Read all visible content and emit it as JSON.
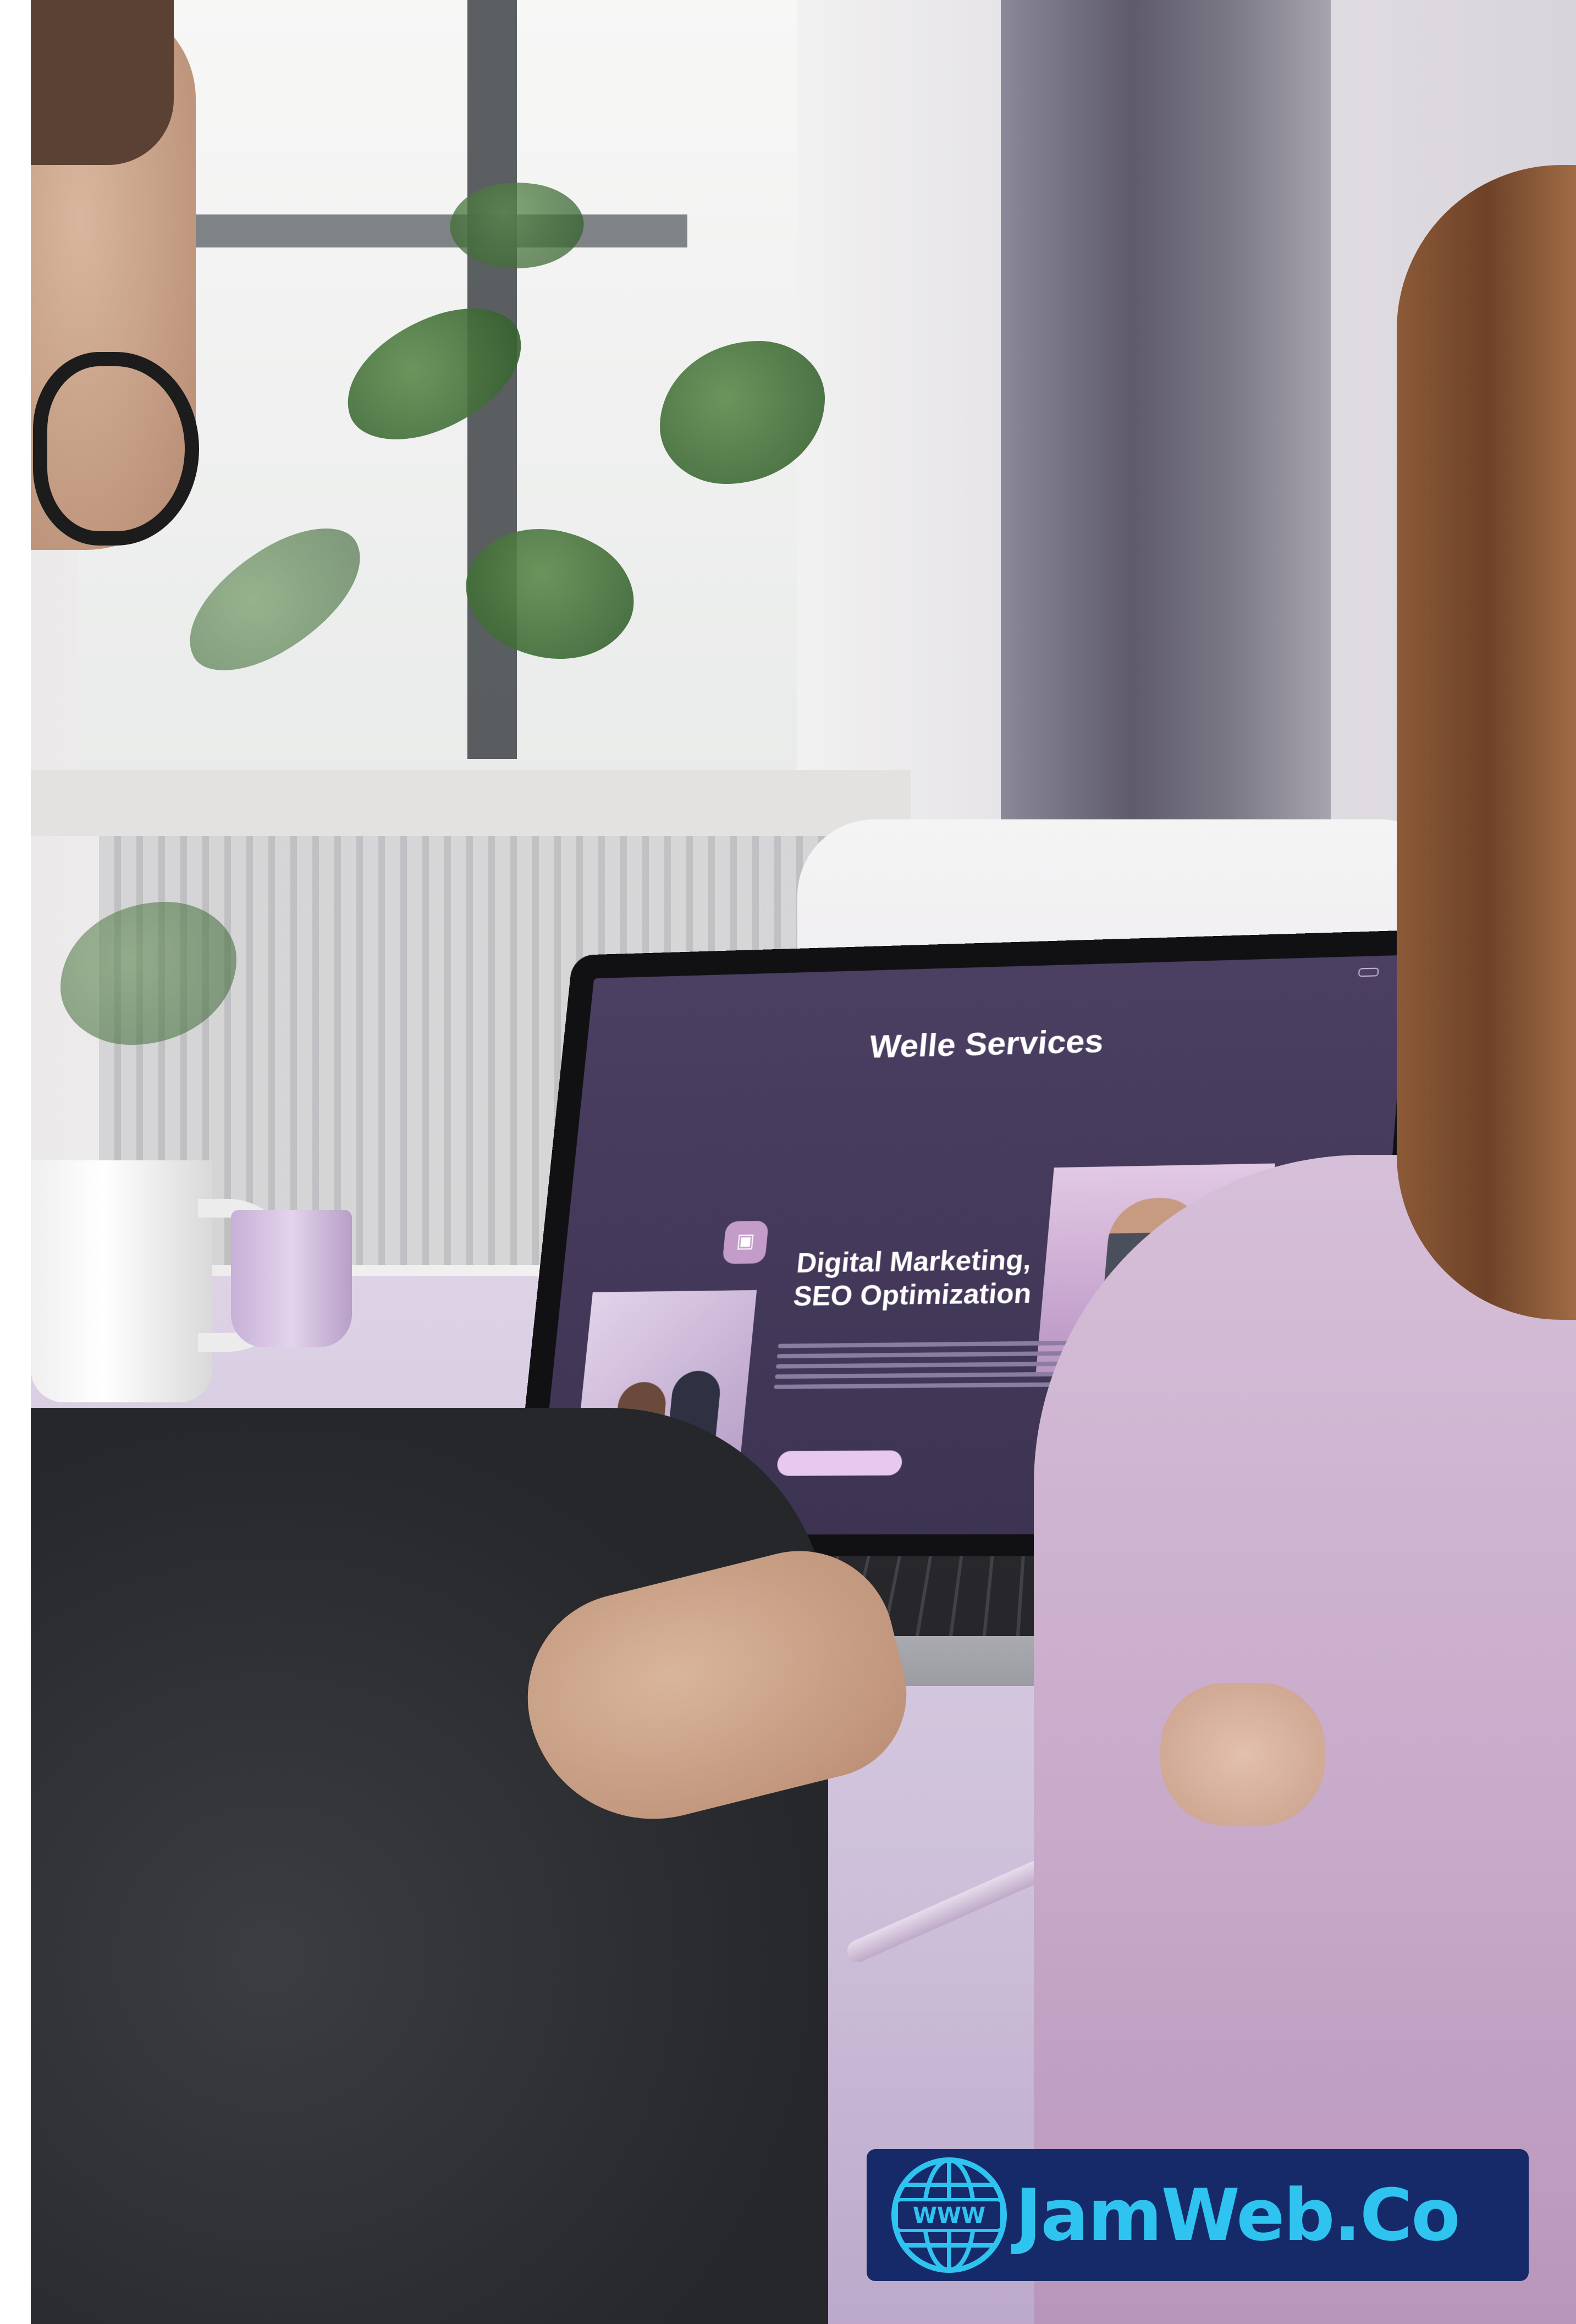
{
  "laptop_site": {
    "logo": "",
    "nav": [
      "",
      "",
      ""
    ],
    "nav_cta": "",
    "title": "Welle Services",
    "subtitle": "",
    "eyebrow": "",
    "heading_line1": "Digital Marketing,",
    "heading_line2": "SEO Optimization",
    "cta": ""
  },
  "brand": {
    "text": "JamWeb.Co",
    "globe_text": "WWW",
    "badge_color": "#162a6a",
    "text_color": "#2fc3ef"
  },
  "colors": {
    "screen_bg": "#4b3f62",
    "table": "#cdbfd9"
  }
}
